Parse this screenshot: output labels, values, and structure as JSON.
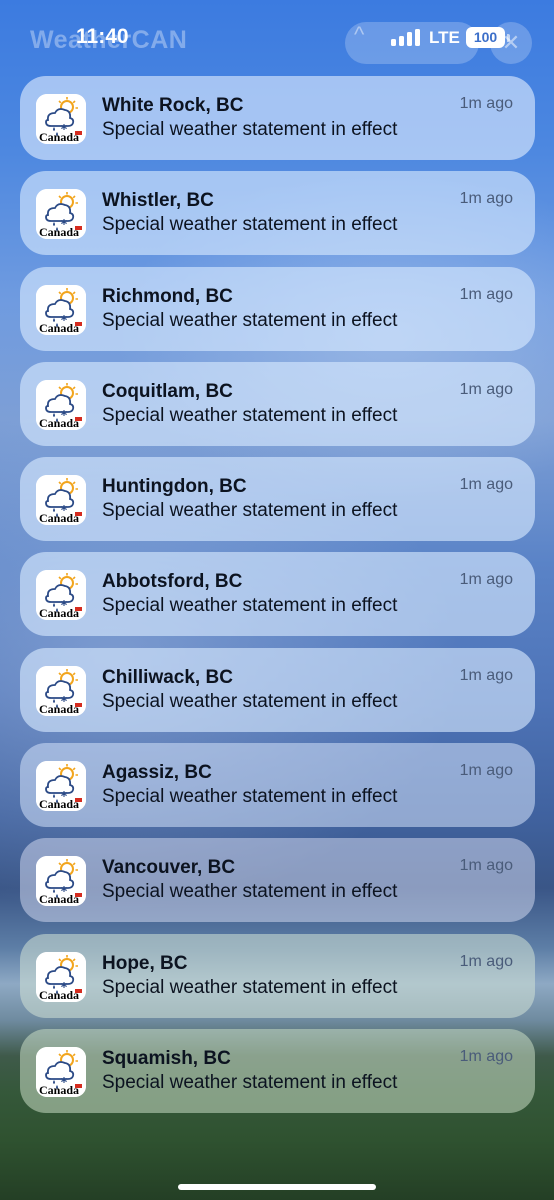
{
  "status_bar": {
    "time": "11:40",
    "network": "LTE",
    "battery": "100",
    "signal_bars": 4
  },
  "background_header": {
    "app_name": "WeatherCAN",
    "collapse_glyph": "^",
    "close_glyph": "✕"
  },
  "app_icon": {
    "name": "canada-weather-icon",
    "wordmark": "Canada"
  },
  "notifications": [
    {
      "title": "White Rock, BC",
      "body": "Special weather statement in effect",
      "time": "1m ago"
    },
    {
      "title": "Whistler, BC",
      "body": "Special weather statement in effect",
      "time": "1m ago"
    },
    {
      "title": "Richmond, BC",
      "body": "Special weather statement in effect",
      "time": "1m ago"
    },
    {
      "title": "Coquitlam, BC",
      "body": "Special weather statement in effect",
      "time": "1m ago"
    },
    {
      "title": "Huntingdon, BC",
      "body": "Special weather statement in effect",
      "time": "1m ago"
    },
    {
      "title": "Abbotsford, BC",
      "body": "Special weather statement in effect",
      "time": "1m ago"
    },
    {
      "title": "Chilliwack, BC",
      "body": "Special weather statement in effect",
      "time": "1m ago"
    },
    {
      "title": "Agassiz, BC",
      "body": "Special weather statement in effect",
      "time": "1m ago"
    },
    {
      "title": "Vancouver, BC",
      "body": "Special weather statement in effect",
      "time": "1m ago"
    },
    {
      "title": "Hope, BC",
      "body": "Special weather statement in effect",
      "time": "1m ago"
    },
    {
      "title": "Squamish, BC",
      "body": "Special weather statement in effect",
      "time": "1m ago"
    }
  ],
  "colors": {
    "sky_top": "#3c7be0",
    "grass": "#2f5230",
    "sun": "#f2a51d",
    "canada_red": "#d52b1e"
  }
}
